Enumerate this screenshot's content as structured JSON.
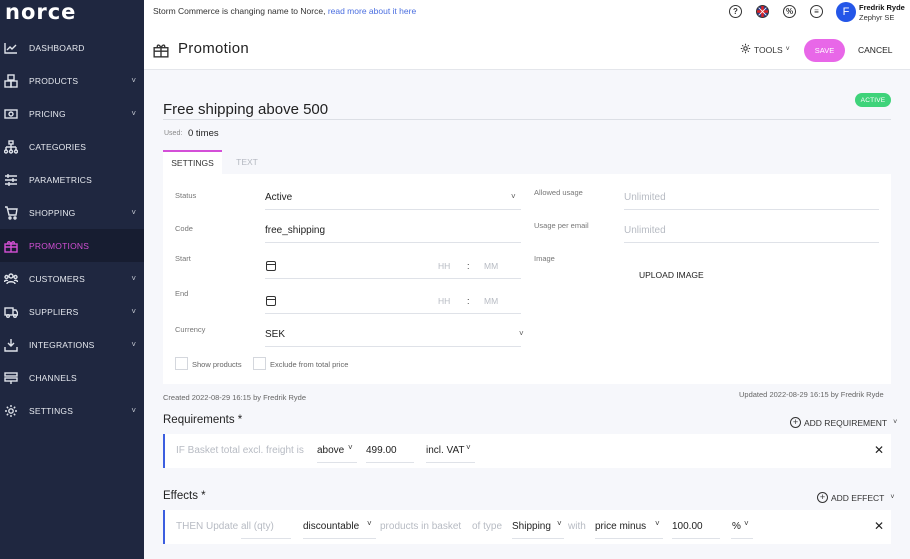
{
  "app": {
    "logo": "norce"
  },
  "sidebar": {
    "items": [
      {
        "label": "DASHBOARD",
        "icon": "chart-line-icon",
        "has_chevron": false,
        "active": false
      },
      {
        "label": "PRODUCTS",
        "icon": "boxes-icon",
        "has_chevron": true,
        "active": false
      },
      {
        "label": "PRICING",
        "icon": "money-icon",
        "has_chevron": true,
        "active": false
      },
      {
        "label": "CATEGORIES",
        "icon": "sitemap-icon",
        "has_chevron": false,
        "active": false
      },
      {
        "label": "PARAMETRICS",
        "icon": "sliders-icon",
        "has_chevron": false,
        "active": false
      },
      {
        "label": "SHOPPING",
        "icon": "cart-icon",
        "has_chevron": true,
        "active": false
      },
      {
        "label": "PROMOTIONS",
        "icon": "gift-icon",
        "has_chevron": false,
        "active": true
      },
      {
        "label": "CUSTOMERS",
        "icon": "users-icon",
        "has_chevron": true,
        "active": false
      },
      {
        "label": "SUPPLIERS",
        "icon": "truck-icon",
        "has_chevron": true,
        "active": false
      },
      {
        "label": "INTEGRATIONS",
        "icon": "download-tray-icon",
        "has_chevron": true,
        "active": false
      },
      {
        "label": "CHANNELS",
        "icon": "signpost-icon",
        "has_chevron": false,
        "active": false
      },
      {
        "label": "SETTINGS",
        "icon": "gear-icon",
        "has_chevron": true,
        "active": false
      }
    ],
    "chevron": "˅"
  },
  "topbar": {
    "notice": "Storm Commerce is changing name to Norce,",
    "notice_link": "read more about it here",
    "icons": [
      "help-icon",
      "flag-uk-icon",
      "percent-icon",
      "menu-circle-icon"
    ],
    "help_glyph": "?",
    "percent_glyph": "%",
    "menu_glyph": "≡",
    "user": {
      "initial": "F",
      "name": "Fredrik Ryde",
      "org": "Zephyr SE"
    }
  },
  "header": {
    "title": "Promotion",
    "tools_label": "TOOLS",
    "save_label": "SAVE",
    "cancel_label": "CANCEL"
  },
  "promotion": {
    "name": "Free shipping above 500",
    "status_badge": "ACTIVE",
    "used_label": "Used:",
    "used_value": "0 times"
  },
  "tabs": [
    {
      "label": "SETTINGS",
      "active": true
    },
    {
      "label": "TEXT",
      "active": false
    }
  ],
  "settings": {
    "status": {
      "label": "Status",
      "value": "Active"
    },
    "code": {
      "label": "Code",
      "value": "free_shipping"
    },
    "start": {
      "label": "Start",
      "hh_placeholder": "HH",
      "mm_placeholder": "MM"
    },
    "end": {
      "label": "End",
      "hh_placeholder": "HH",
      "mm_placeholder": "MM"
    },
    "time_separator": ":",
    "currency": {
      "label": "Currency",
      "value": "SEK"
    },
    "allowed_usage": {
      "label": "Allowed usage",
      "placeholder": "Unlimited"
    },
    "usage_per_email": {
      "label": "Usage per email",
      "placeholder": "Unlimited"
    },
    "image": {
      "label": "Image",
      "upload_label": "UPLOAD IMAGE"
    },
    "show_products": {
      "label": "Show products",
      "checked": false
    },
    "exclude_total": {
      "label": "Exclude from total price",
      "checked": false
    }
  },
  "meta": {
    "created": "Created 2022-08-29 16:15 by Fredrik Ryde",
    "updated": "Updated 2022-08-29 16:15 by Fredrik Ryde"
  },
  "requirements": {
    "title": "Requirements *",
    "add_label": "ADD REQUIREMENT",
    "rows": [
      {
        "prefix": "IF Basket total excl. freight is",
        "comparator": "above",
        "amount": "499.00",
        "vat": "incl. VAT"
      }
    ]
  },
  "effects": {
    "title": "Effects *",
    "add_label": "ADD EFFECT",
    "rows": [
      {
        "prefix": "THEN Update",
        "qty_placeholder": "all (qty)",
        "scope": "discountable",
        "mid_text": "products in basket",
        "type_text": "of type",
        "type": "Shipping",
        "with_text": "with",
        "operation": "price minus",
        "amount": "100.00",
        "unit": "%"
      }
    ]
  },
  "glyphs": {
    "chevron": "˅",
    "close": "✕",
    "plus": "+"
  }
}
